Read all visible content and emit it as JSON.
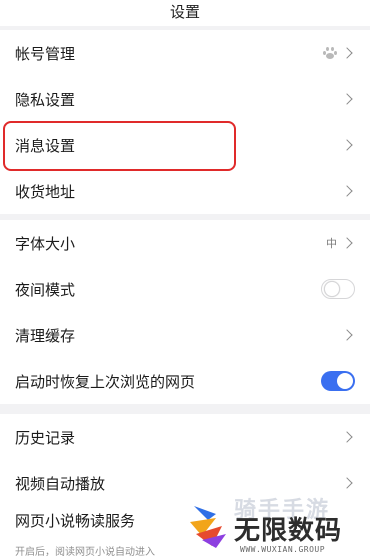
{
  "header": {
    "title": "设置"
  },
  "groups": [
    {
      "items": [
        {
          "label": "帐号管理",
          "right": "paw-icon"
        },
        {
          "label": "隐私设置",
          "right": "chevron"
        },
        {
          "label": "消息设置",
          "right": "chevron"
        },
        {
          "label": "收货地址",
          "right": "chevron"
        }
      ]
    },
    {
      "items": [
        {
          "label": "字体大小",
          "value": "中",
          "right": "chevron"
        },
        {
          "label": "夜间模式",
          "toggle": false
        },
        {
          "label": "清理缓存",
          "right": "chevron"
        },
        {
          "label": "启动时恢复上次浏览的网页",
          "toggle": true
        }
      ]
    },
    {
      "items": [
        {
          "label": "历史记录",
          "right": "chevron"
        },
        {
          "label": "视频自动播放",
          "right": "chevron"
        },
        {
          "label": "网页小说畅读服务",
          "subtitle": "开启后，阅读网页小说自动进入"
        }
      ]
    }
  ],
  "watermark": {
    "cn_top": "骑手手游",
    "cn_main": "无限数码",
    "en": "WWW.WUXIAN.GROUP"
  },
  "colors": {
    "accent": "#3a6ff0",
    "highlight": "#e02a2a"
  }
}
